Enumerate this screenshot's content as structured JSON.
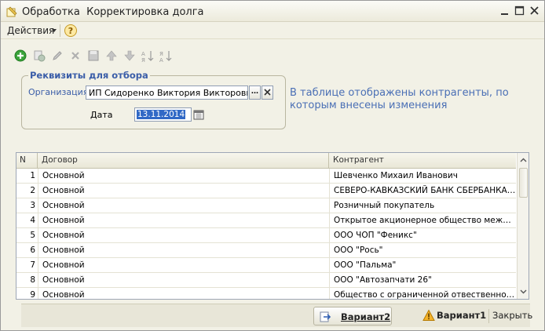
{
  "window": {
    "title": "Обработка  Корректировка долга"
  },
  "menu": {
    "actions_label": "Действия",
    "help_icon": "question-circle-icon"
  },
  "toolbar": {
    "icons": [
      "add-icon",
      "copy-icon",
      "edit-icon",
      "delete-icon",
      "save-icon",
      "move-up-icon",
      "move-down-icon",
      "sort-asc-icon",
      "sort-desc-icon"
    ]
  },
  "filter": {
    "group_title": "Реквизиты для отбора",
    "org_label": "Организация",
    "org_value": "ИП Сидоренко Виктория Викторовна",
    "org_select_label": "...",
    "date_label": "Дата",
    "date_value": "13.11.2014"
  },
  "info_text": "В таблице отображены контрагенты, по которым внесены изменения",
  "table": {
    "columns": [
      "N",
      "Договор",
      "Контрагент"
    ],
    "rows": [
      {
        "n": "1",
        "contract": "Основной",
        "counterparty": "Шевченко Михаил Иванович"
      },
      {
        "n": "2",
        "contract": "Основной",
        "counterparty": "СЕВЕРО-КАВКАЗСКИЙ БАНК СБЕРБАНКА ..."
      },
      {
        "n": "3",
        "contract": "Основной",
        "counterparty": "Розничный покупатель"
      },
      {
        "n": "4",
        "contract": "Основной",
        "counterparty": "Открытое акционерное общество междуго..."
      },
      {
        "n": "5",
        "contract": "Основной",
        "counterparty": "ООО ЧОП \"Феникс\""
      },
      {
        "n": "6",
        "contract": "Основной",
        "counterparty": "ООО \"Рось\""
      },
      {
        "n": "7",
        "contract": "Основной",
        "counterparty": "ООО \"Пальма\""
      },
      {
        "n": "8",
        "contract": "Основной",
        "counterparty": "ООО \"Автозапчати 26\""
      },
      {
        "n": "9",
        "contract": "Основной",
        "counterparty": "Общество с ограниченной отвественность..."
      }
    ]
  },
  "buttons": {
    "variant2": "Вариант2",
    "variant1": "Вариант1",
    "close": "Закрыть"
  },
  "colors": {
    "accent_blue": "#3a5da8",
    "info_blue": "#4a6fb5",
    "selection": "#3169c6",
    "add_green": "#3aa33a"
  }
}
